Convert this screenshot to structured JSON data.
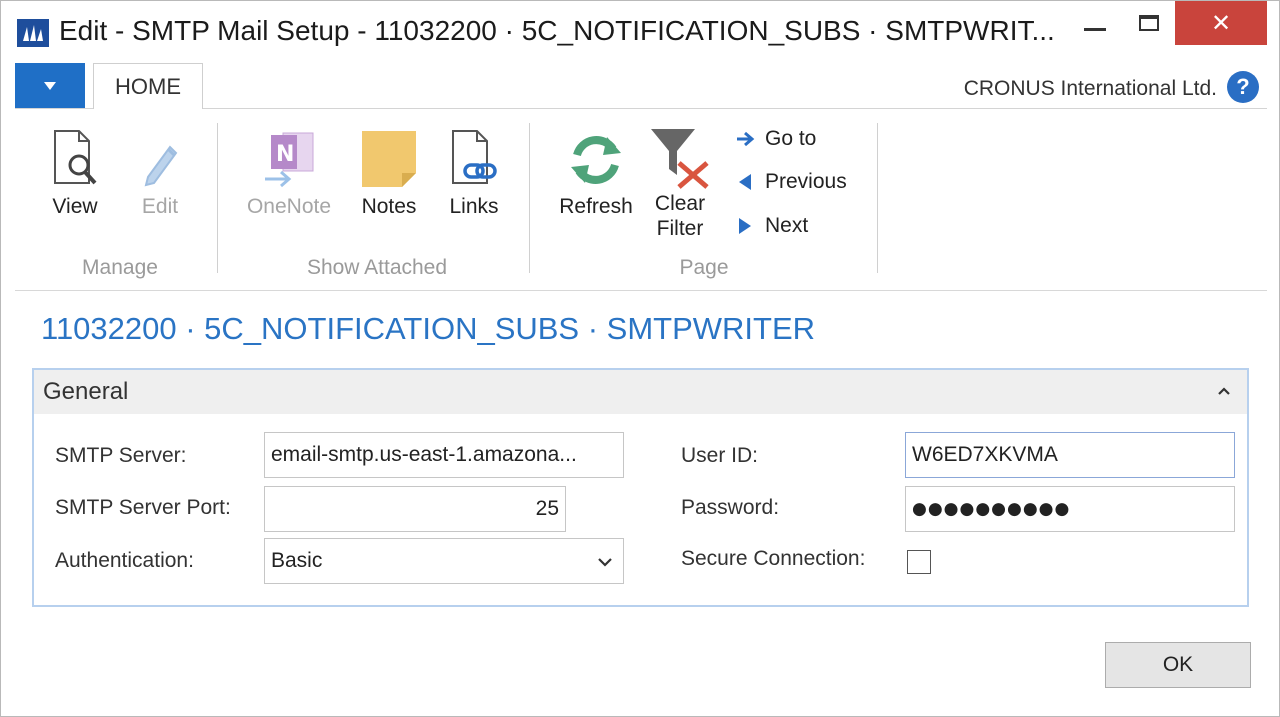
{
  "window": {
    "title": "Edit - SMTP Mail Setup - 11032200 · 5C_NOTIFICATION_SUBS · SMTPWRIT...",
    "close_glyph": "✕"
  },
  "ribbon": {
    "tab_home": "HOME",
    "company": "CRONUS International Ltd.",
    "help_glyph": "?",
    "groups": {
      "manage": {
        "caption": "Manage",
        "view": "View",
        "edit": "Edit"
      },
      "show_attached": {
        "caption": "Show Attached",
        "onenote": "OneNote",
        "notes": "Notes",
        "links": "Links"
      },
      "page": {
        "caption": "Page",
        "refresh": "Refresh",
        "clear_filter_1": "Clear",
        "clear_filter_2": "Filter",
        "go_to": "Go to",
        "previous": "Previous",
        "next": "Next"
      }
    }
  },
  "page": {
    "title": "11032200 · 5C_NOTIFICATION_SUBS · SMTPWRITER"
  },
  "general": {
    "header": "General",
    "smtp_server_label": "SMTP Server:",
    "smtp_server_value": "email-smtp.us-east-1.amazona...",
    "smtp_port_label": "SMTP Server Port:",
    "smtp_port_value": "25",
    "auth_label": "Authentication:",
    "auth_value": "Basic",
    "user_id_label": "User ID:",
    "user_id_value": "W6ED7XKVMA",
    "password_label": "Password:",
    "password_value": "●●●●●●●●●●",
    "secure_label": "Secure Connection:",
    "secure_checked": false
  },
  "footer": {
    "ok_label": "OK"
  },
  "colors": {
    "accent": "#2a74c4",
    "file_tab": "#1f6fc6",
    "close_button": "#c9443c",
    "refresh_icon": "#4fa37a",
    "notes_icon": "#f1c86e",
    "onenote_icon": "#b589c9"
  }
}
